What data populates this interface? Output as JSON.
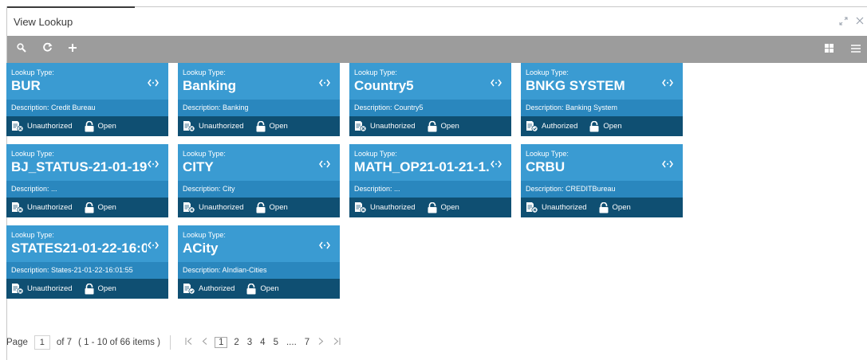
{
  "window": {
    "title": "View Lookup"
  },
  "tiles": [
    {
      "label": "Lookup Type:",
      "name": "BUR",
      "description": "Description: Credit Bureau",
      "auth": "Unauthorized",
      "status": "Open",
      "authorized": false
    },
    {
      "label": "Lookup Type:",
      "name": "Banking",
      "description": "Description: Banking",
      "auth": "Unauthorized",
      "status": "Open",
      "authorized": false
    },
    {
      "label": "Lookup Type:",
      "name": "Country5",
      "description": "Description: Country5",
      "auth": "Unauthorized",
      "status": "Open",
      "authorized": false
    },
    {
      "label": "Lookup Type:",
      "name": "BNKG SYSTEM",
      "description": "Description: Banking System",
      "auth": "Authorized",
      "status": "Open",
      "authorized": true
    },
    {
      "label": "Lookup Type:",
      "name": "BJ_STATUS-21-01-19...",
      "description": "Description: ...",
      "auth": "Unauthorized",
      "status": "Open",
      "authorized": false
    },
    {
      "label": "Lookup Type:",
      "name": "CITY",
      "description": "Description: City",
      "auth": "Unauthorized",
      "status": "Open",
      "authorized": false
    },
    {
      "label": "Lookup Type:",
      "name": "MATH_OP21-01-21-1...",
      "description": "Description: ...",
      "auth": "Unauthorized",
      "status": "Open",
      "authorized": false
    },
    {
      "label": "Lookup Type:",
      "name": "CRBU",
      "description": "Description: CREDITBureau",
      "auth": "Unauthorized",
      "status": "Open",
      "authorized": false
    },
    {
      "label": "Lookup Type:",
      "name": "STATES21-01-22-16:0...",
      "description": "Description: States-21-01-22-16:01:55",
      "auth": "Unauthorized",
      "status": "Open",
      "authorized": false
    },
    {
      "label": "Lookup Type:",
      "name": "ACity",
      "description": "Description: AIndian-Cities",
      "auth": "Authorized",
      "status": "Open",
      "authorized": true
    }
  ],
  "pager": {
    "page_label": "Page",
    "current_page": "1",
    "of_text": "of 7",
    "items_text": "( 1 - 10 of 66 items )",
    "pages": [
      "1",
      "2",
      "3",
      "4",
      "5",
      "....",
      "7"
    ]
  },
  "colors": {
    "tile_header": "#3a9bd2",
    "tile_desc": "#2a87be",
    "tile_status": "#0f4f72",
    "toolbar": "#9c9c9c"
  }
}
